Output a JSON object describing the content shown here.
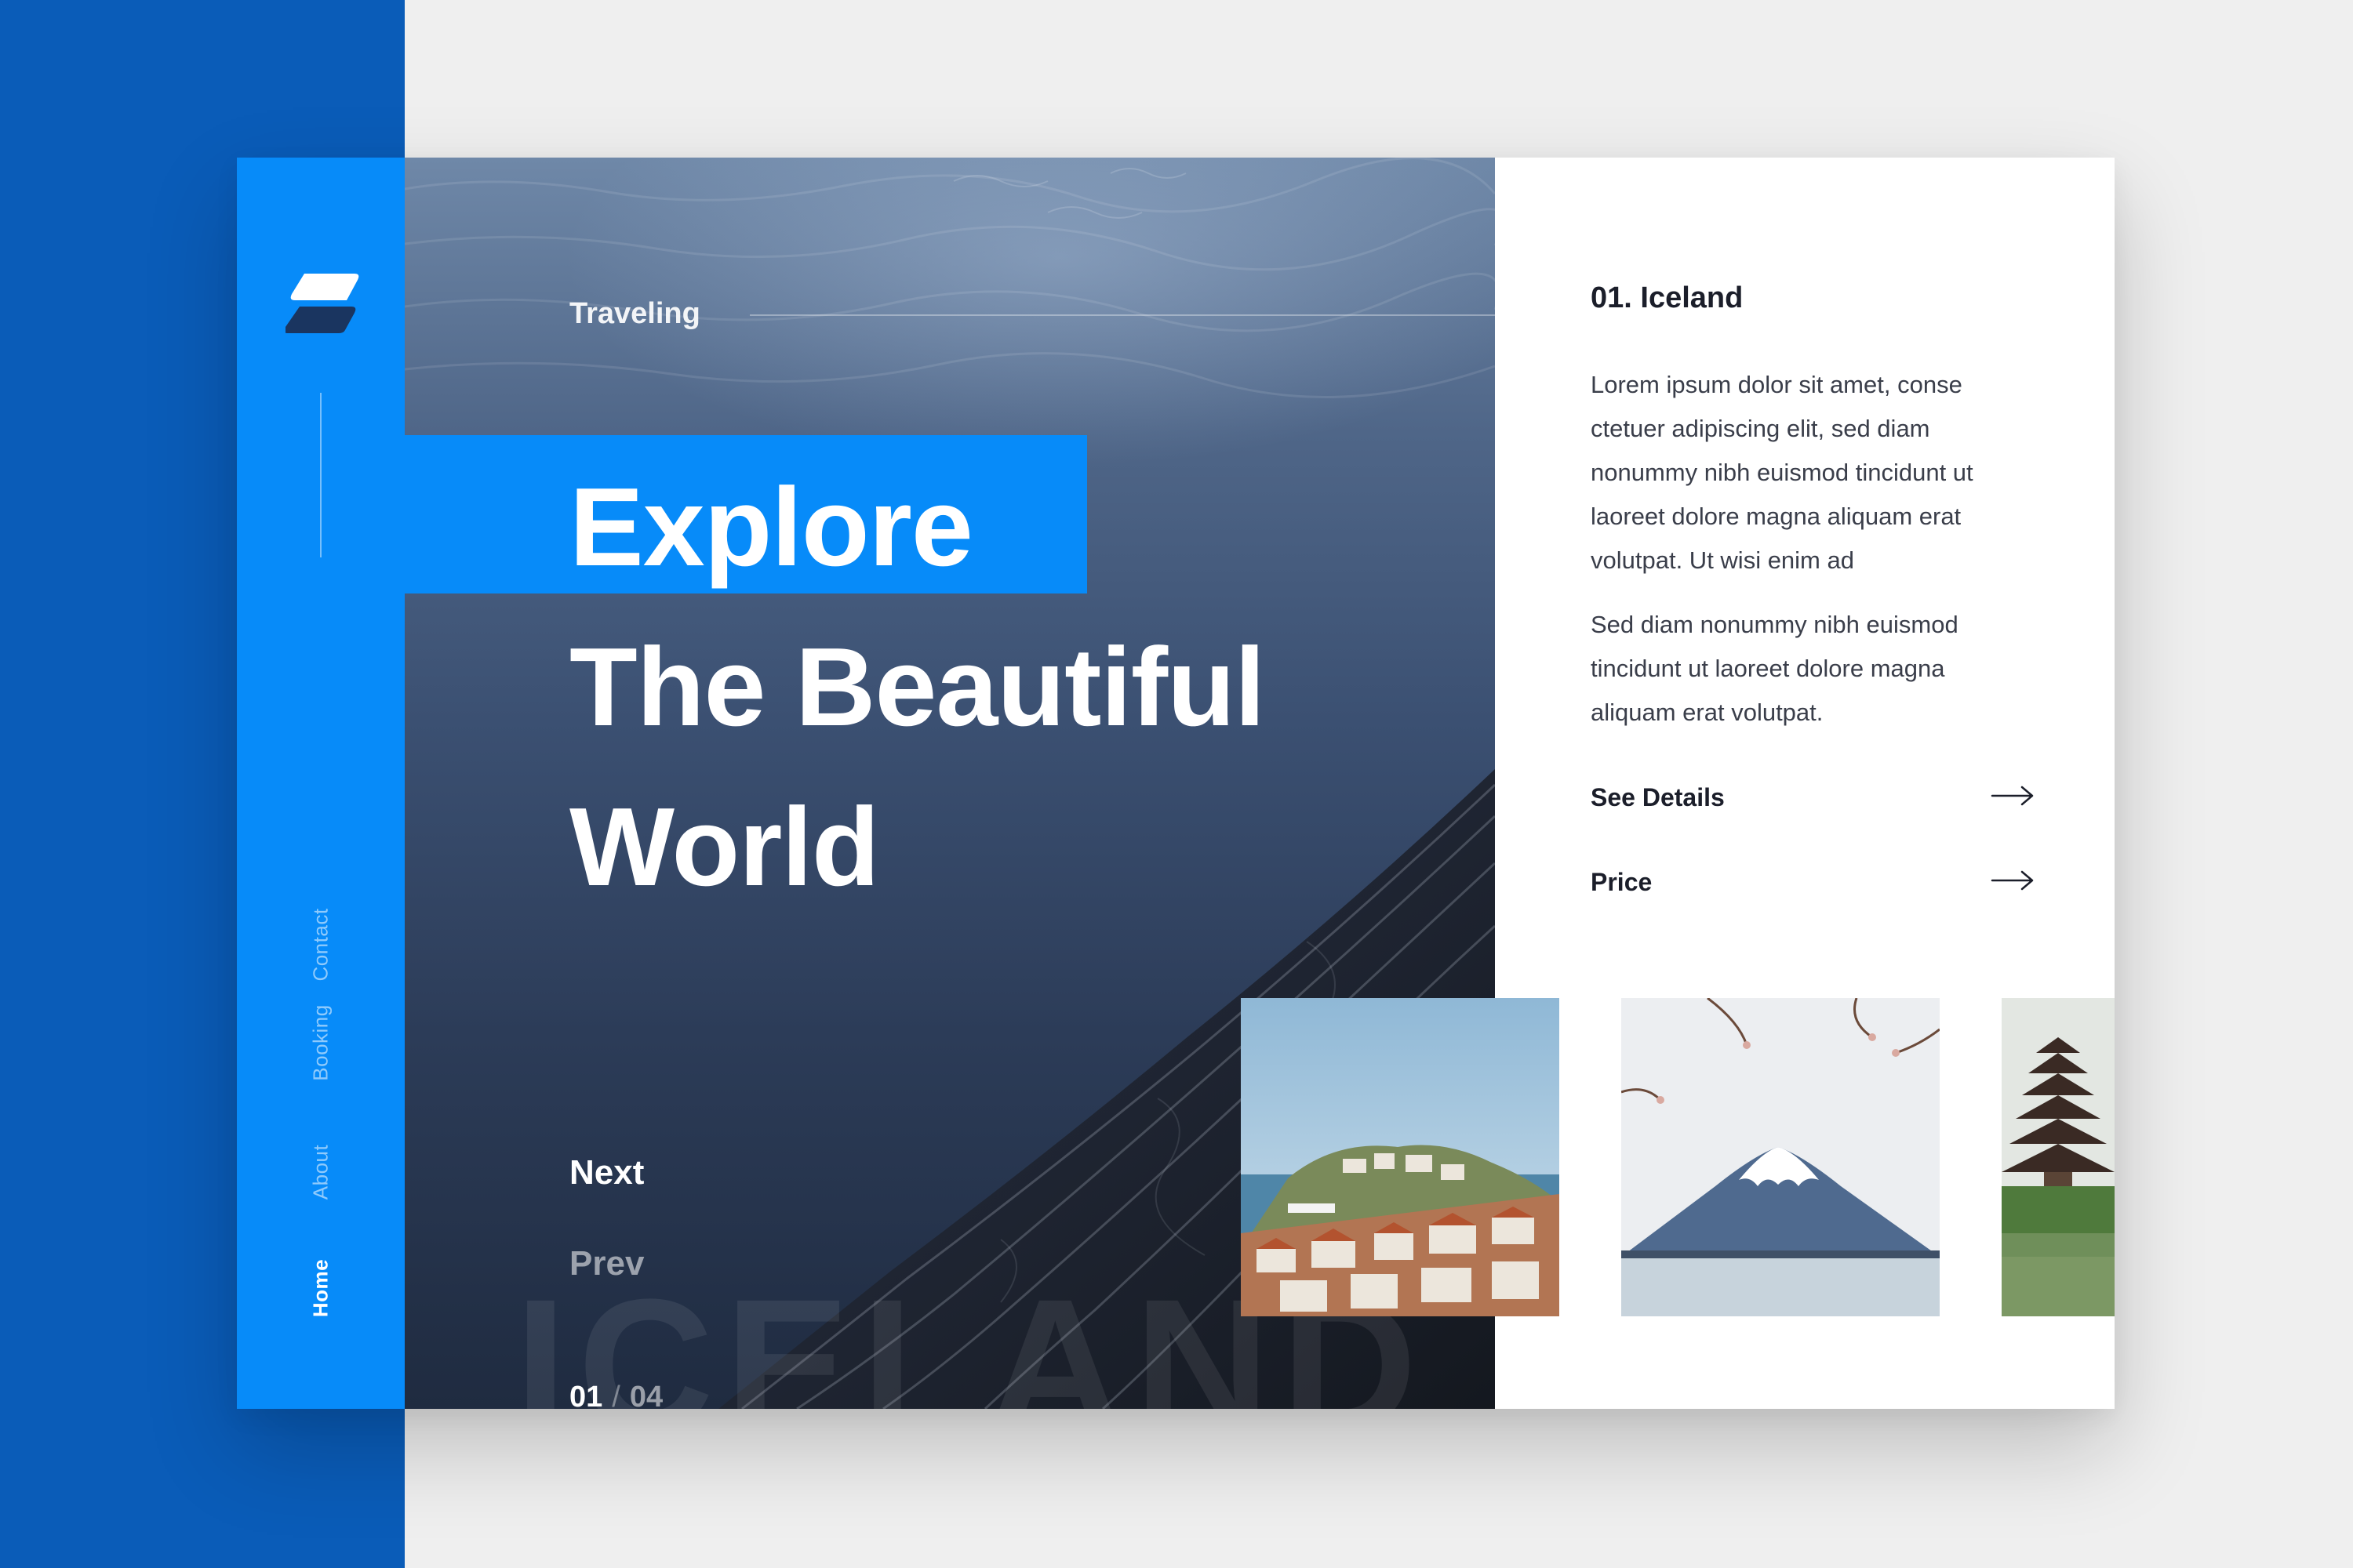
{
  "nav": {
    "items": [
      {
        "label": "Contact"
      },
      {
        "label": "Booking"
      },
      {
        "label": "About"
      },
      {
        "label": "Home"
      }
    ],
    "active": "Home"
  },
  "hero": {
    "kicker": "Traveling",
    "headline": [
      "Explore",
      "The Beautiful",
      "World"
    ],
    "next_label": "Next",
    "prev_label": "Prev",
    "counter_current": "01",
    "counter_separator": "/",
    "counter_total": "04",
    "ghost_text": "ICELAND"
  },
  "detail": {
    "title": "01. Iceland",
    "paragraphs": [
      "Lorem ipsum dolor sit amet, conse ctetuer adipiscing elit, sed diam nonummy nibh euismod tincidunt ut laoreet dolore magna aliquam erat volutpat. Ut wisi enim ad",
      "Sed diam nonummy nibh euismod tincidunt ut laoreet dolore magna aliquam erat volutpat."
    ],
    "actions": [
      {
        "label": "See Details",
        "icon": "arrow-right-icon"
      },
      {
        "label": "Price",
        "icon": "arrow-right-icon"
      }
    ]
  },
  "thumbnails": [
    {
      "icon": "coastal-town-photo"
    },
    {
      "icon": "mount-fuji-photo"
    },
    {
      "icon": "pagoda-temple-photo"
    }
  ],
  "colors": {
    "brand_blue": "#078bf9",
    "dark_blue": "#0a5cb8",
    "background": "#efefef",
    "text_dark": "#1b1e2a"
  }
}
